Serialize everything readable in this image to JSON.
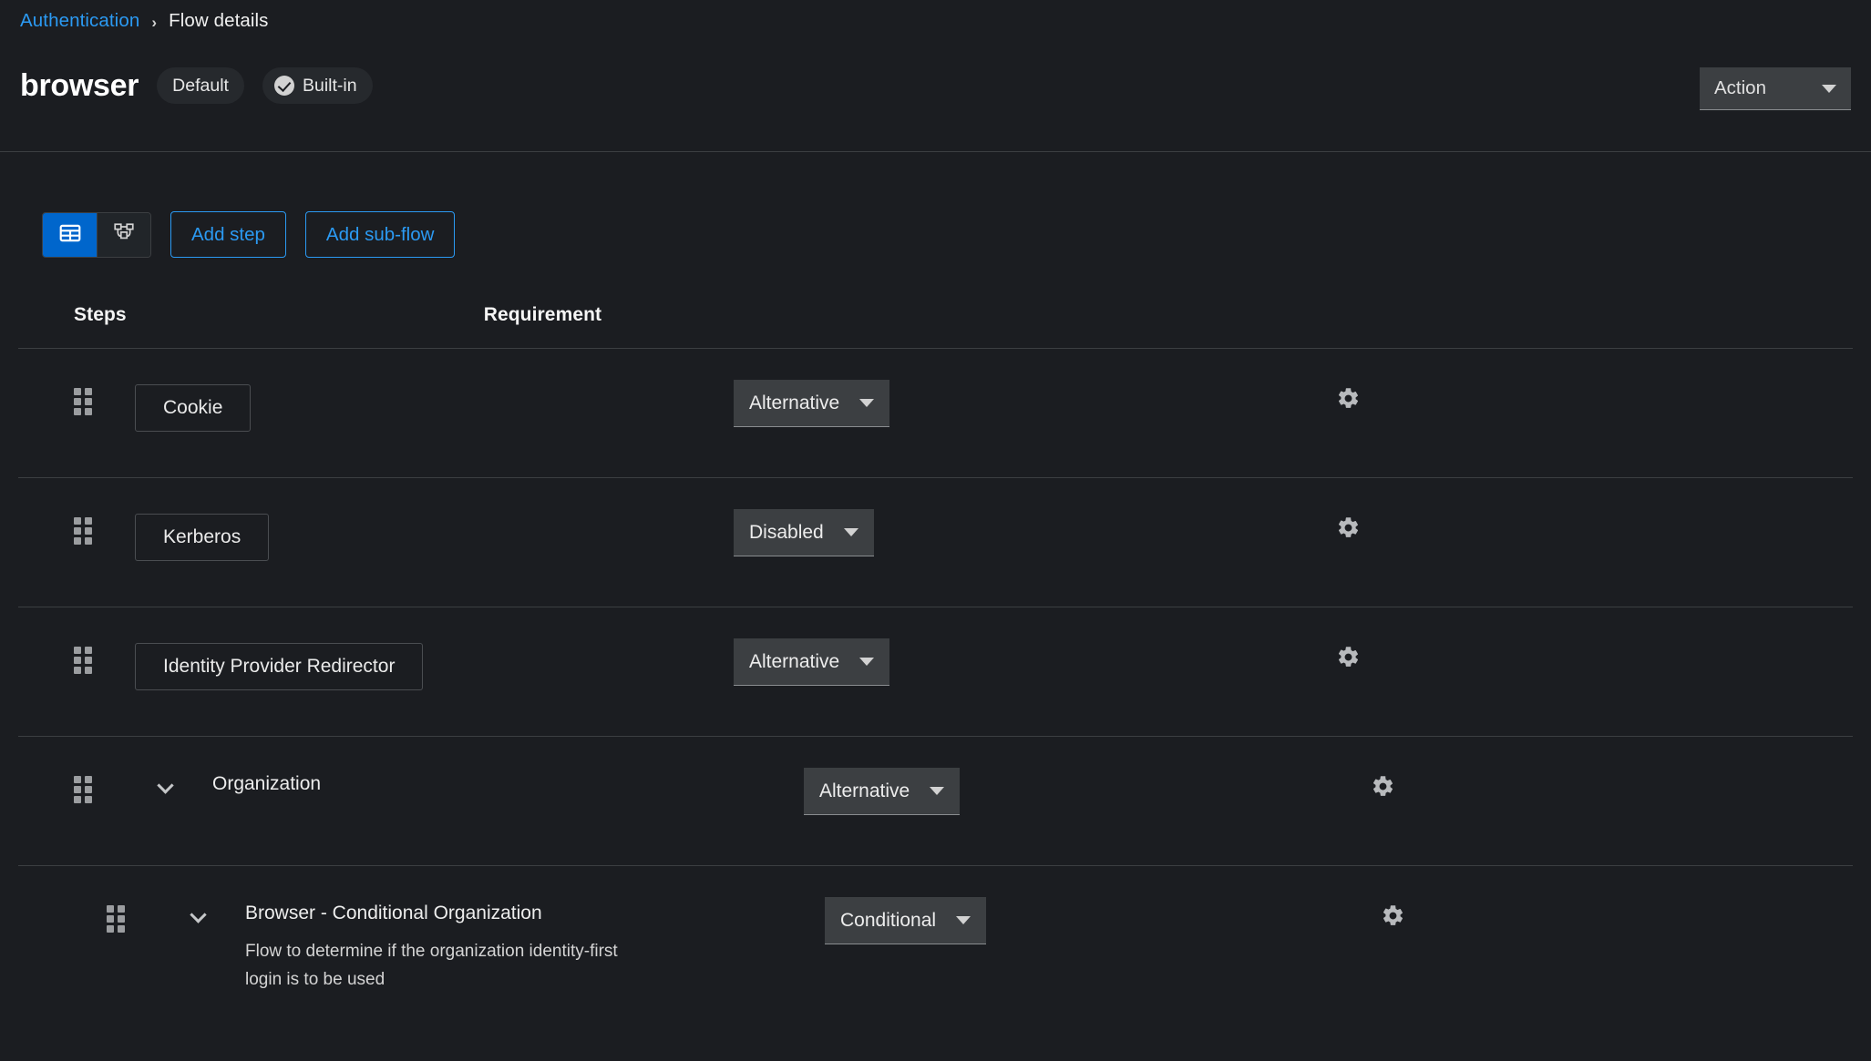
{
  "breadcrumb": {
    "parent": "Authentication",
    "separator": "›",
    "current": "Flow details"
  },
  "header": {
    "flow_name": "browser",
    "badges": [
      {
        "label": "Default",
        "icon": null
      },
      {
        "label": "Built-in",
        "icon": "check-circle-icon"
      }
    ],
    "action_dropdown": {
      "label": "Action",
      "icon": "caret-down-icon"
    }
  },
  "toolbar": {
    "view_toggle": [
      {
        "name": "table-view",
        "icon": "table-icon",
        "active": true
      },
      {
        "name": "diagram-view",
        "icon": "topology-icon",
        "active": false
      }
    ],
    "add_step_label": "Add step",
    "add_subflow_label": "Add sub-flow"
  },
  "table": {
    "columns": [
      "Steps",
      "Requirement"
    ],
    "rows": [
      {
        "name": "Cookie",
        "description": null,
        "requirement": "Alternative",
        "type": "execution",
        "indent": 0,
        "expandable": false,
        "settings_icon": "gear-icon",
        "drag_icon": "drag-handle-icon"
      },
      {
        "name": "Kerberos",
        "description": null,
        "requirement": "Disabled",
        "type": "execution",
        "indent": 0,
        "expandable": false,
        "settings_icon": "gear-icon",
        "drag_icon": "drag-handle-icon"
      },
      {
        "name": "Identity Provider Redirector",
        "description": null,
        "requirement": "Alternative",
        "type": "execution",
        "indent": 0,
        "expandable": false,
        "settings_icon": "gear-icon",
        "drag_icon": "drag-handle-icon"
      },
      {
        "name": "Organization",
        "description": null,
        "requirement": "Alternative",
        "type": "subflow",
        "indent": 0,
        "expandable": true,
        "settings_icon": "gear-icon",
        "drag_icon": "drag-handle-icon"
      },
      {
        "name": "Browser - Conditional Organization",
        "description": "Flow to determine if the organization identity-first login is to be used",
        "requirement": "Conditional",
        "type": "subflow",
        "indent": 1,
        "expandable": true,
        "settings_icon": "gear-icon",
        "drag_icon": "drag-handle-icon"
      }
    ]
  },
  "colors": {
    "background": "#1b1d21",
    "accent_blue": "#0066cc",
    "link_blue": "#2b9af3",
    "dropdown_bg": "#3c3f42",
    "border": "#3c3f42"
  }
}
